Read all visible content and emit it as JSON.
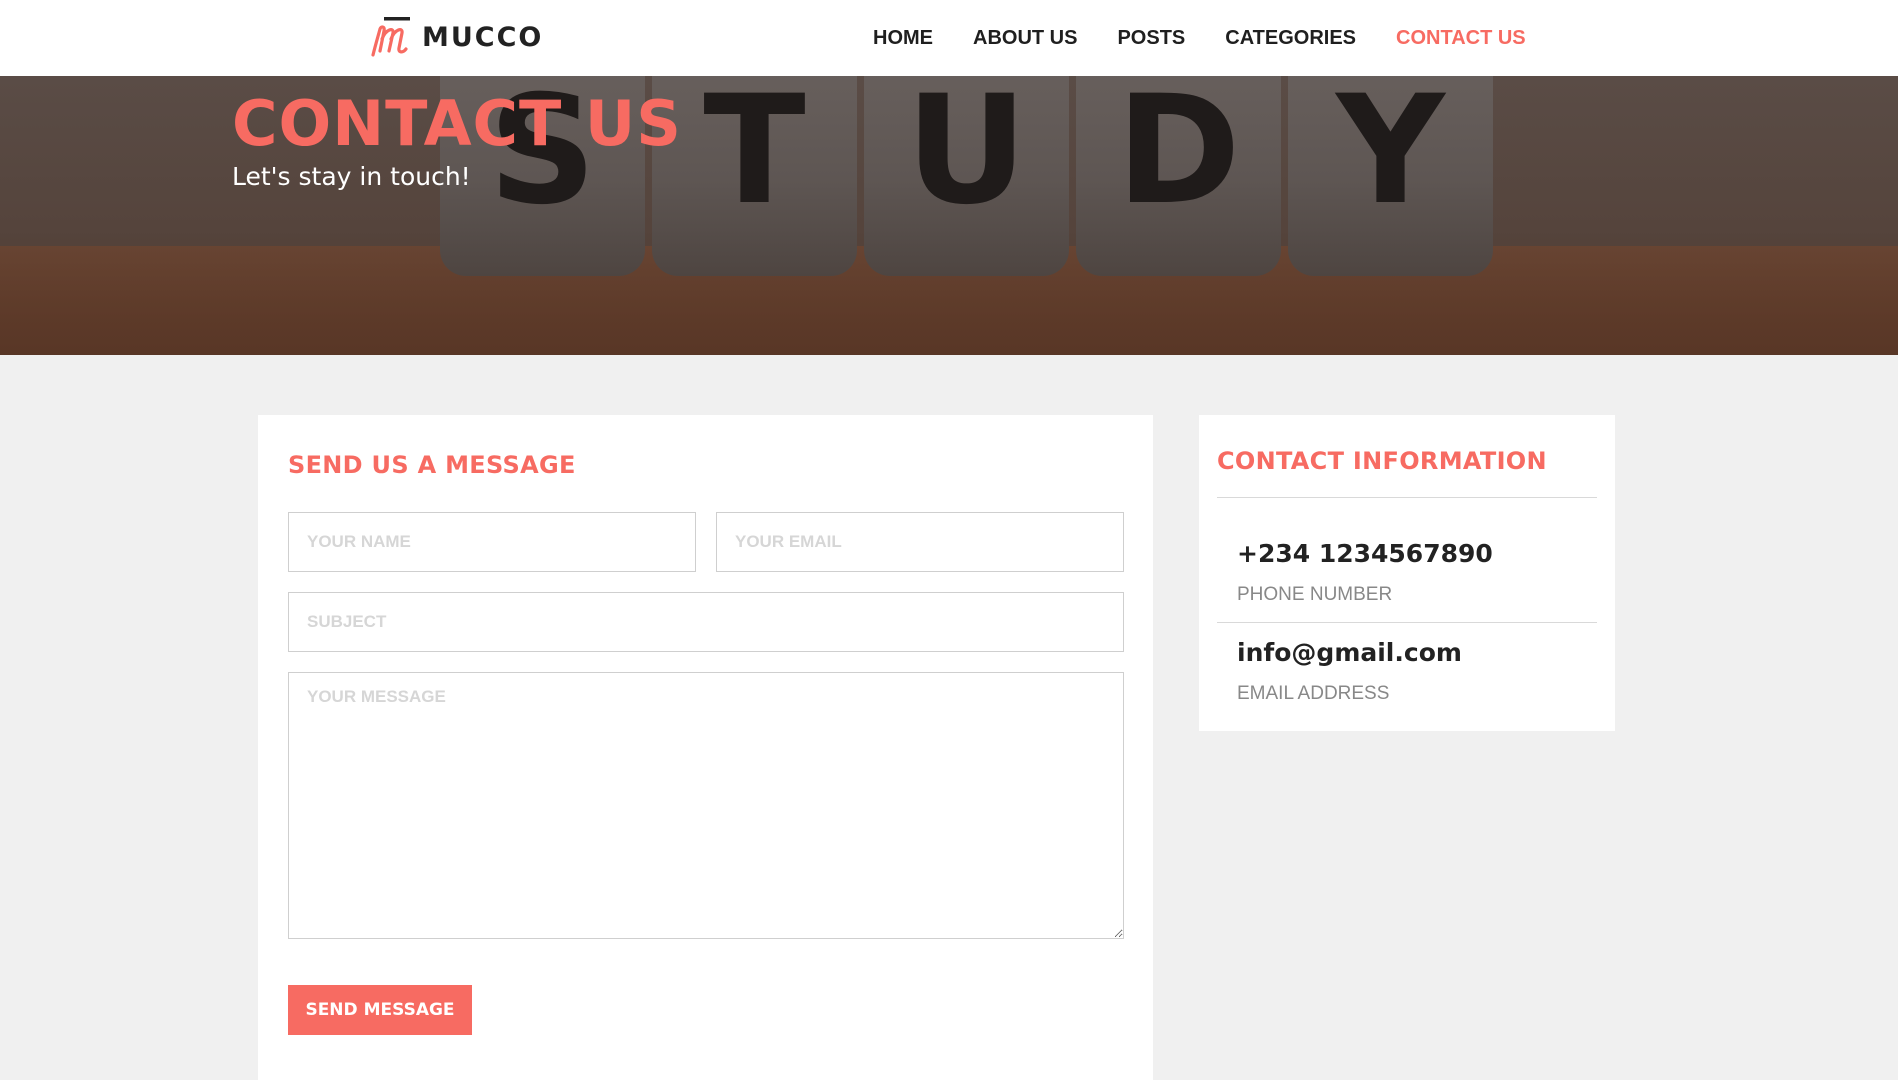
{
  "brand": {
    "name": "MUCCO",
    "logo_letter": "m"
  },
  "nav": {
    "items": [
      {
        "label": "HOME"
      },
      {
        "label": "ABOUT US"
      },
      {
        "label": "POSTS"
      },
      {
        "label": "CATEGORIES"
      },
      {
        "label": "CONTACT US",
        "active": true
      }
    ]
  },
  "hero": {
    "title": "CONTACT US",
    "subtitle": "Let's stay in touch!",
    "background_letters": [
      "S",
      "T",
      "U",
      "D",
      "Y"
    ]
  },
  "message_form": {
    "title": "SEND US A MESSAGE",
    "name_placeholder": "YOUR NAME",
    "email_placeholder": "YOUR EMAIL",
    "subject_placeholder": "SUBJECT",
    "message_placeholder": "YOUR MESSAGE",
    "submit_label": "SEND MESSAGE"
  },
  "contact_info": {
    "title": "CONTACT INFORMATION",
    "phone": {
      "value": "+234 1234567890",
      "label": "PHONE NUMBER"
    },
    "email": {
      "value": "info@gmail.com",
      "label": "EMAIL ADDRESS"
    }
  },
  "colors": {
    "accent": "#f76b62",
    "text_dark": "#222222",
    "page_bg": "#f0f0f0"
  }
}
